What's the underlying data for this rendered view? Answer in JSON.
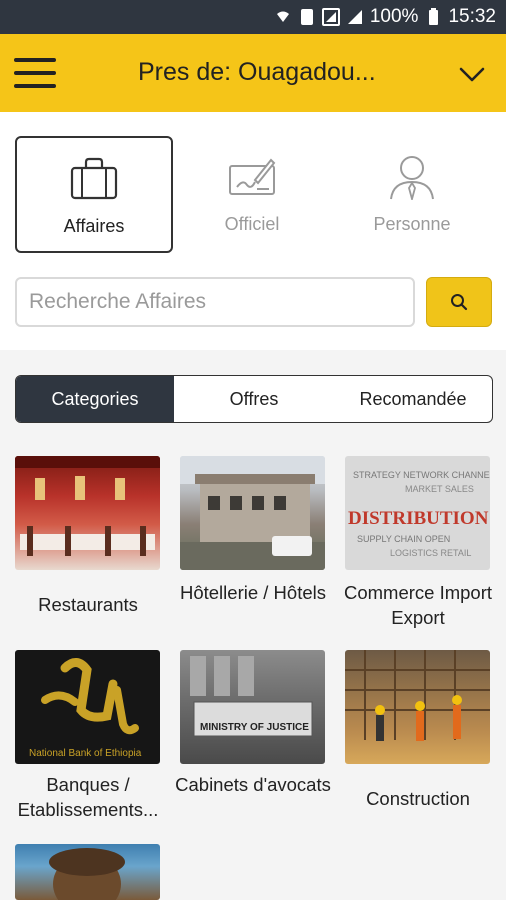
{
  "status_bar": {
    "battery": "100%",
    "time": "15:32"
  },
  "app_bar": {
    "title": "Pres de: Ouagadou..."
  },
  "type_tabs": [
    {
      "label": "Affaires",
      "icon": "briefcase-icon",
      "active": true
    },
    {
      "label": "Officiel",
      "icon": "document-signature-icon",
      "active": false
    },
    {
      "label": "Personne",
      "icon": "person-icon",
      "active": false
    }
  ],
  "search": {
    "placeholder": "Recherche Affaires"
  },
  "segments": [
    {
      "label": "Categories",
      "active": true
    },
    {
      "label": "Offres",
      "active": false
    },
    {
      "label": "Recomandée",
      "active": false
    }
  ],
  "categories": [
    {
      "label": "Restaurants"
    },
    {
      "label": "Hôtellerie / Hôtels"
    },
    {
      "label": "Commerce Import Export"
    },
    {
      "label": "Banques / Etablissements..."
    },
    {
      "label": "Cabinets d'avocats"
    },
    {
      "label": "Construction"
    }
  ],
  "image_text": {
    "distribution": "DISTRIBUTION",
    "bank": "National Bank of Ethiopia",
    "justice": "MINISTRY OF JUSTICE"
  },
  "colors": {
    "accent": "#f5c518",
    "dark": "#2f3640"
  }
}
